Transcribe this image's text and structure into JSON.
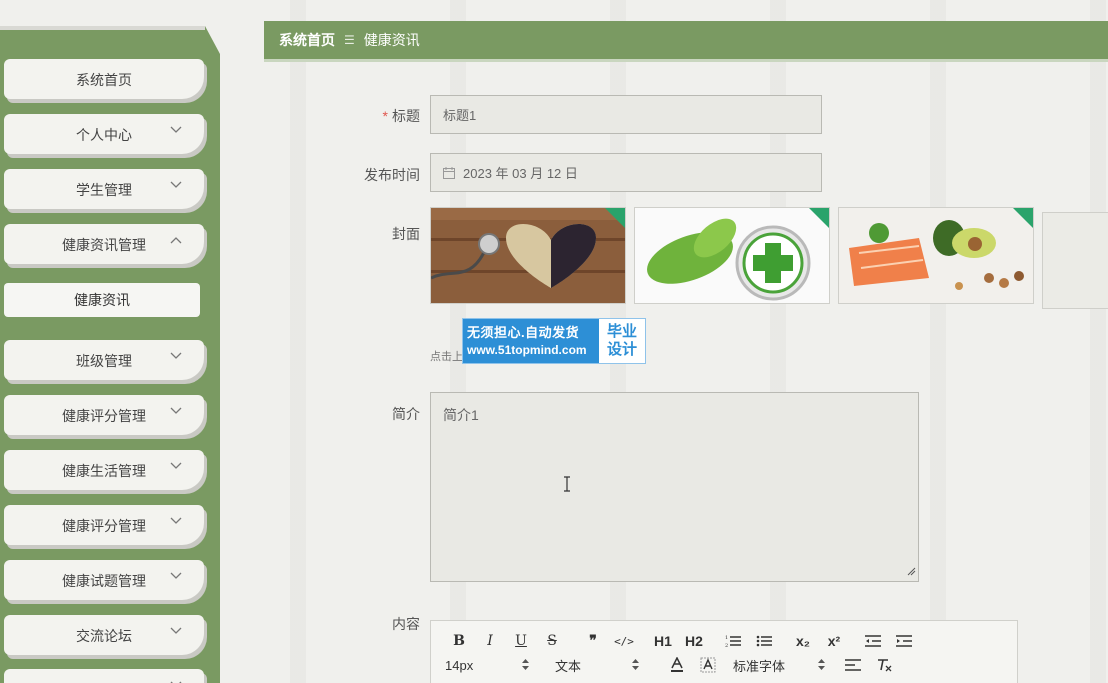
{
  "sidebar": {
    "items": [
      {
        "label": "系统首页",
        "has_chevron": false
      },
      {
        "label": "个人中心",
        "has_chevron": true,
        "chevron": "down"
      },
      {
        "label": "学生管理",
        "has_chevron": true,
        "chevron": "down"
      },
      {
        "label": "健康资讯管理",
        "has_chevron": true,
        "chevron": "up"
      },
      {
        "label": "班级管理",
        "has_chevron": true,
        "chevron": "down"
      },
      {
        "label": "健康评分管理",
        "has_chevron": true,
        "chevron": "down"
      },
      {
        "label": "健康生活管理",
        "has_chevron": true,
        "chevron": "down"
      },
      {
        "label": "健康评分管理",
        "has_chevron": true,
        "chevron": "down"
      },
      {
        "label": "健康试题管理",
        "has_chevron": true,
        "chevron": "down"
      },
      {
        "label": "交流论坛",
        "has_chevron": true,
        "chevron": "down"
      }
    ],
    "sub_item": "健康资讯"
  },
  "breadcrumb": {
    "home": "系统首页",
    "separator": "☰",
    "current": "健康资讯"
  },
  "form": {
    "title_label": "标题",
    "title_required_mark": "*",
    "title_value": "标题1",
    "date_label": "发布时间",
    "date_value": "2023 年 03 月 12 日",
    "cover_label": "封面",
    "upload_hint": "点击上",
    "intro_label": "简介",
    "intro_value": "简介1",
    "content_label": "内容"
  },
  "watermark": {
    "line1": "无须担心.自动发货",
    "line2": "www.51topmind.com",
    "right1": "毕业",
    "right2": "设计"
  },
  "editor_toolbar": {
    "row1": [
      "B",
      "I",
      "U",
      "S",
      "❞",
      "</>",
      "H1",
      "H2",
      "ol",
      "ul",
      "x₂",
      "x²",
      "outdent",
      "indent"
    ],
    "font_size": "14px",
    "block_type": "文本",
    "font_family": "标准字体"
  },
  "colors": {
    "accent": "#7a9a62",
    "required": "#e0554d",
    "watermark_blue": "#2d8fd6"
  }
}
